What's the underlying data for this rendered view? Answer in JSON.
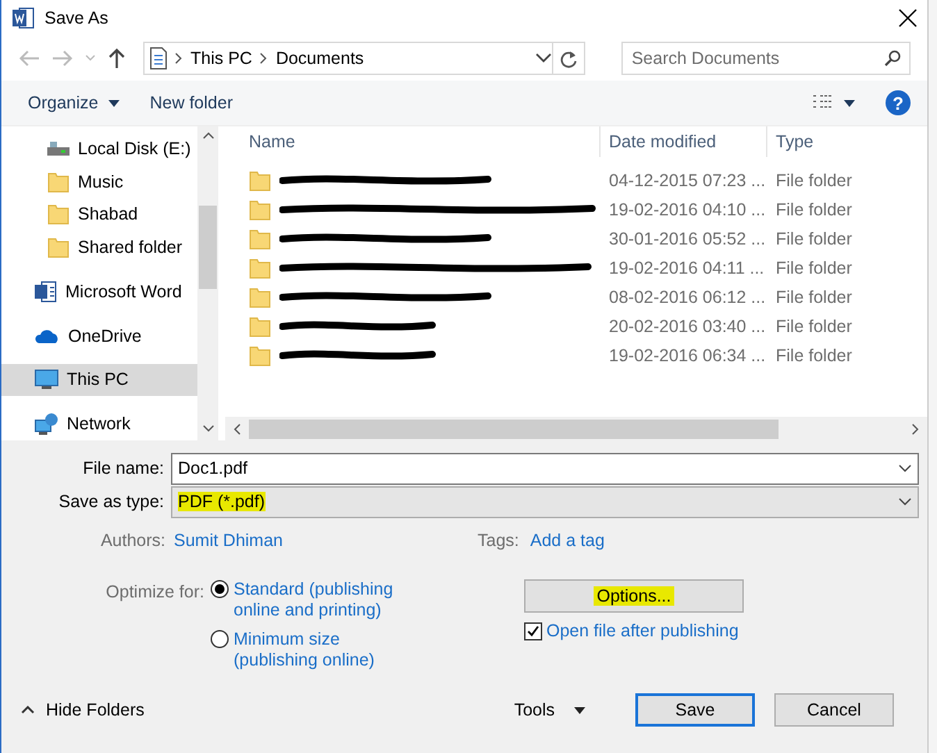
{
  "window": {
    "title": "Save As"
  },
  "address": {
    "path": [
      "This PC",
      "Documents"
    ]
  },
  "search": {
    "placeholder": "Search Documents"
  },
  "toolbar": {
    "organize": "Organize",
    "new_folder": "New folder",
    "help": "?"
  },
  "sidebar": {
    "items": [
      {
        "label": "Local Disk (E:)",
        "kind": "drive",
        "selected": false
      },
      {
        "label": "Music",
        "kind": "folder",
        "selected": false
      },
      {
        "label": "Shabad",
        "kind": "folder",
        "selected": false
      },
      {
        "label": "Shared folder",
        "kind": "folder",
        "selected": false
      },
      {
        "label": "Microsoft Word",
        "kind": "word",
        "selected": false
      },
      {
        "label": "OneDrive",
        "kind": "cloud",
        "selected": false
      },
      {
        "label": "This PC",
        "kind": "pc",
        "selected": true
      },
      {
        "label": "Network",
        "kind": "network",
        "selected": false
      }
    ]
  },
  "table": {
    "columns": [
      "Name",
      "Date modified",
      "Type"
    ],
    "rows": [
      {
        "redacted": true,
        "date": "04-12-2015 07:23 ...",
        "type": "File folder"
      },
      {
        "redacted": true,
        "date": "19-02-2016 04:10 ...",
        "type": "File folder"
      },
      {
        "redacted": true,
        "date": "30-01-2016 05:52 ...",
        "type": "File folder"
      },
      {
        "redacted": true,
        "date": "19-02-2016 04:11 ...",
        "type": "File folder"
      },
      {
        "redacted": true,
        "date": "08-02-2016 06:12 ...",
        "type": "File folder"
      },
      {
        "redacted": true,
        "date": "20-02-2016 03:40 ...",
        "type": "File folder"
      },
      {
        "redacted": true,
        "date": "19-02-2016 06:34 ...",
        "type": "File folder"
      }
    ]
  },
  "form": {
    "file_name": {
      "label": "File name:",
      "value": "Doc1.pdf"
    },
    "save_as_type": {
      "label": "Save as type:",
      "value": "PDF (*.pdf)",
      "highlighted": true
    },
    "authors": {
      "label": "Authors:",
      "value": "Sumit Dhiman"
    },
    "tags": {
      "label": "Tags:",
      "value": "Add a tag"
    },
    "optimize": {
      "label": "Optimize for:",
      "options": [
        {
          "label": "Standard (publishing online and printing)",
          "selected": true
        },
        {
          "label": "Minimum size (publishing online)",
          "selected": false
        }
      ]
    },
    "options_button": {
      "label": "Options...",
      "highlighted": true
    },
    "open_after": {
      "label": "Open file after publishing",
      "checked": true
    }
  },
  "footer": {
    "hide_folders": "Hide Folders",
    "tools": "Tools",
    "buttons": [
      {
        "label": "Save",
        "default": true
      },
      {
        "label": "Cancel",
        "default": false
      }
    ]
  }
}
